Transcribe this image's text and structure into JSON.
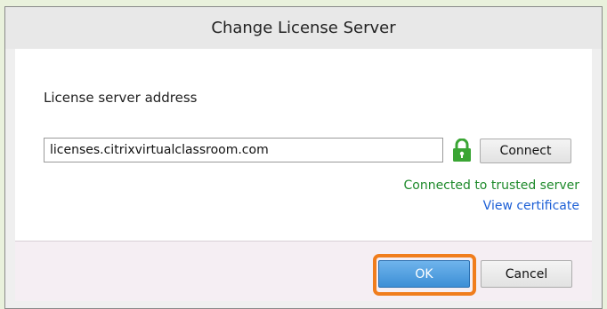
{
  "dialog": {
    "title": "Change License Server"
  },
  "content": {
    "section_label": "License server address",
    "address_value": "licenses.citrixvirtualclassroom.com",
    "connect_label": "Connect",
    "status_text": "Connected to trusted server",
    "status_color": "#1e8a2b",
    "view_certificate_label": "View certificate",
    "link_color": "#1c5fd6",
    "lock_icon": "lock-icon",
    "lock_color": "#3aa534"
  },
  "footer": {
    "ok_label": "OK",
    "cancel_label": "Cancel",
    "highlight_color": "#f07d1c"
  }
}
